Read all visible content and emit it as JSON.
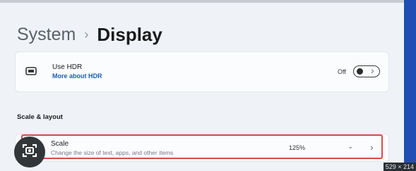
{
  "breadcrumb": {
    "parent": "System",
    "separator": "›",
    "current": "Display"
  },
  "hdr": {
    "title": "Use HDR",
    "link": "More about HDR",
    "state_label": "Off",
    "toggle_on": false
  },
  "section": {
    "title": "Scale & layout"
  },
  "scale": {
    "title": "Scale",
    "subtitle": "Change the size of text, apps, and other items",
    "value": "125%"
  },
  "image_badge": "529 × 214",
  "colors": {
    "accent_link": "#1a5fb4",
    "highlight_border": "#d84b4b",
    "right_strip": "#1f4fb3"
  },
  "icons": [
    "monitor-icon",
    "chevron-right-icon",
    "chevron-down-icon",
    "screen-capture-icon"
  ]
}
